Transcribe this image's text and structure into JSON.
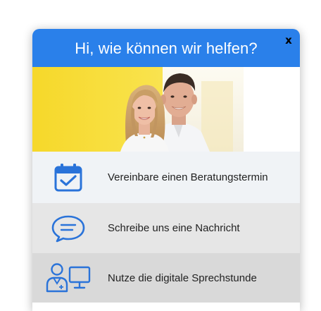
{
  "header": {
    "title": "Hi, wie können wir helfen?",
    "close_label": "x"
  },
  "options": [
    {
      "label": "Vereinbare einen Beratungstermin",
      "icon": "calendar-check-icon"
    },
    {
      "label": "Schreibe uns eine Nachricht",
      "icon": "chat-bubble-icon"
    },
    {
      "label": "Nutze die digitale Sprechstunde",
      "icon": "doctor-monitor-icon"
    }
  ],
  "colors": {
    "header_bg": "#2a80ea",
    "icon_blue": "#2a73d9",
    "photo_yellow": "#f7de2a"
  }
}
